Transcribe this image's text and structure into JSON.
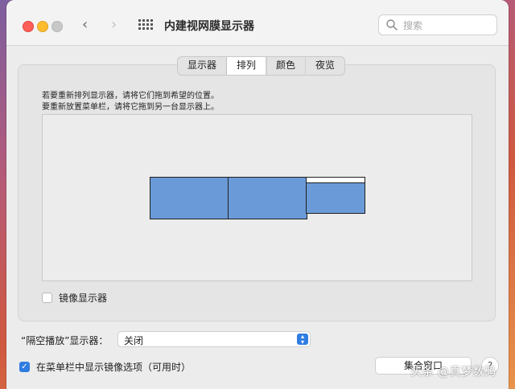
{
  "window": {
    "title": "内建视网膜显示器"
  },
  "toolbar": {
    "back_icon": "chevron-left-icon",
    "forward_icon": "chevron-right-icon",
    "grid_icon": "grid-icon",
    "search_placeholder": "搜索"
  },
  "tabs": [
    {
      "label": "显示器",
      "active": false
    },
    {
      "label": "排列",
      "active": true
    },
    {
      "label": "颜色",
      "active": false
    },
    {
      "label": "夜览",
      "active": false
    }
  ],
  "arrangement": {
    "instruction_1": "若要重新排列显示器，请将它们拖到希望的位置。",
    "instruction_2": "要重新放置菜单栏，请将它拖到另一台显示器上。",
    "display_color": "#6a9bd8"
  },
  "mirror": {
    "label": "镜像显示器",
    "checked": false
  },
  "airplay": {
    "label": "“隔空播放”显示器：",
    "value": "关闭"
  },
  "show_in_menubar": {
    "label": "在菜单栏中显示镜像选项（可用时）",
    "checked": true
  },
  "gather_button": {
    "label": "集合窗口"
  },
  "help_button": {
    "label": "?"
  },
  "watermark": {
    "text": "头条 @真梦数码"
  },
  "colors": {
    "accent": "#2f7de1",
    "close": "#fe5f57",
    "minimize": "#febc2e"
  }
}
